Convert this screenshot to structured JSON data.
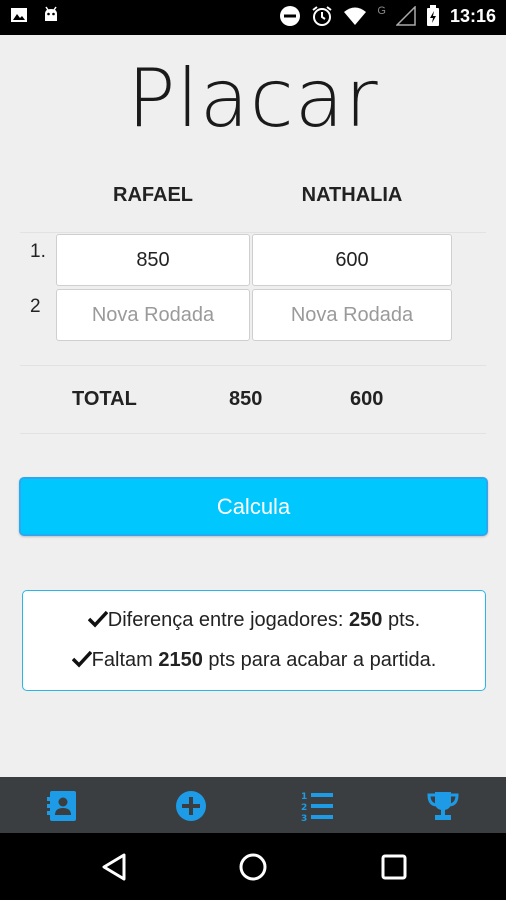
{
  "status_bar": {
    "time": "13:16",
    "network_letter": "G"
  },
  "title": "Placar",
  "players": [
    "RAFAEL",
    "NATHALIA"
  ],
  "rounds": [
    {
      "number": "1.",
      "p1_value": "850",
      "p2_value": "600"
    },
    {
      "number": "2",
      "p1_placeholder": "Nova Rodada",
      "p2_placeholder": "Nova Rodada"
    }
  ],
  "totals": {
    "label": "TOTAL",
    "p1": "850",
    "p2": "600"
  },
  "calculate_button": "Calcula",
  "info": {
    "line1_prefix": "Diferença entre jogadores: ",
    "line1_value": "250",
    "line1_suffix": " pts.",
    "line2_prefix": "Faltam ",
    "line2_value": "2150",
    "line2_suffix": " pts para acabar a partida."
  },
  "tabs": [
    "contacts-icon",
    "add-icon",
    "ranked-list-icon",
    "trophy-icon"
  ],
  "colors": {
    "accent": "#00c8ff",
    "tab_icon": "#1e9be6",
    "info_border": "#29b6e6",
    "tabbar_bg": "#3b3e40"
  }
}
